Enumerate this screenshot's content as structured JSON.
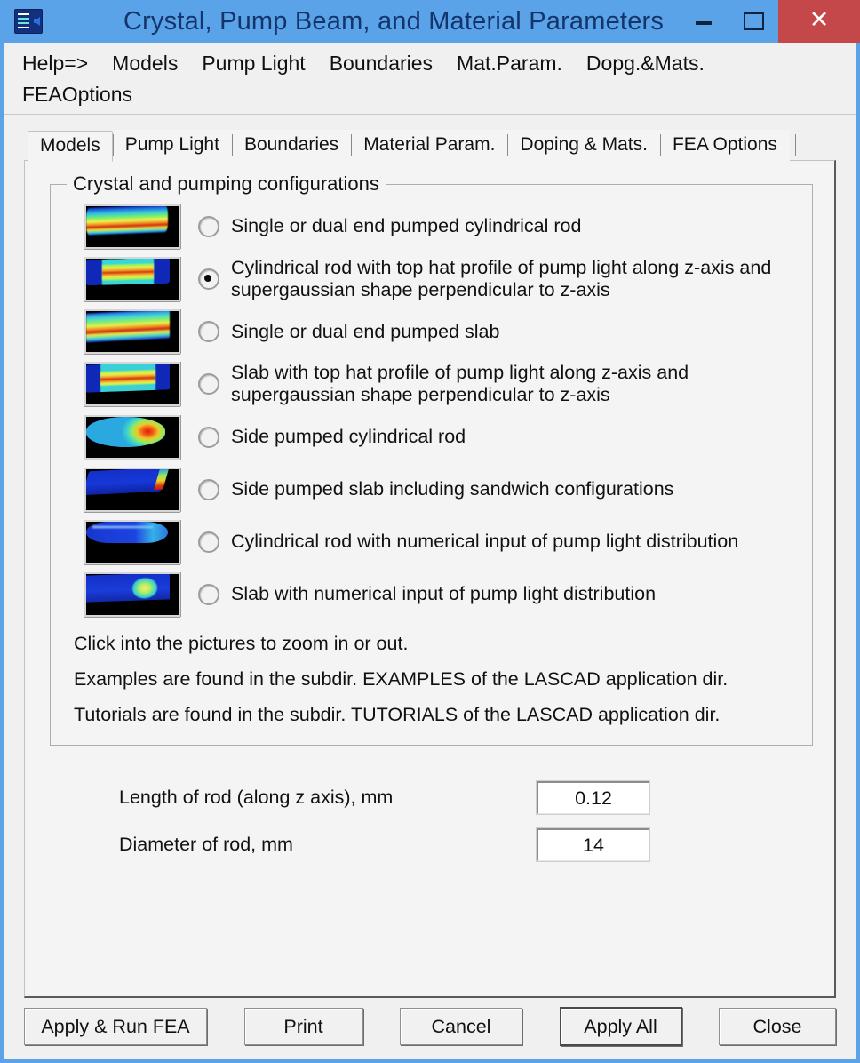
{
  "window": {
    "title": "Crystal, Pump Beam, and Material Parameters",
    "icon": "app-window-icon",
    "minimize_label": "–",
    "maximize_label": "□",
    "close_label": "✕",
    "titlebar_color": "#5BA3E8",
    "close_button_color": "#C4484A"
  },
  "menu": {
    "row1": [
      {
        "label": "Help=>"
      },
      {
        "label": "Models"
      },
      {
        "label": "Pump Light"
      },
      {
        "label": "Boundaries"
      },
      {
        "label": "Mat.Param."
      },
      {
        "label": "Dopg.&Mats."
      }
    ],
    "row2": [
      {
        "label": "FEAOptions"
      }
    ]
  },
  "tabs": [
    {
      "label": "Models",
      "active": true
    },
    {
      "label": "Pump Light",
      "active": false
    },
    {
      "label": "Boundaries",
      "active": false
    },
    {
      "label": "Material Param.",
      "active": false
    },
    {
      "label": "Doping & Mats.",
      "active": false
    },
    {
      "label": "FEA Options",
      "active": false
    }
  ],
  "group": {
    "legend": "Crystal and pumping configurations",
    "options": [
      {
        "label": "Single or dual end pumped cylindrical rod",
        "selected": false,
        "thumb": "end-pumped-rod-thumbnail"
      },
      {
        "label": "Cylindrical rod with top hat profile of pump light along z-axis and supergaussian shape perpendicular to z-axis",
        "selected": true,
        "thumb": "tophat-rod-thumbnail"
      },
      {
        "label": "Single or dual end pumped slab",
        "selected": false,
        "thumb": "end-pumped-slab-thumbnail"
      },
      {
        "label": "Slab with top hat profile of pump light along z-axis and supergaussian shape perpendicular to z-axis",
        "selected": false,
        "thumb": "tophat-slab-thumbnail"
      },
      {
        "label": "Side pumped cylindrical rod",
        "selected": false,
        "thumb": "side-pumped-rod-thumbnail"
      },
      {
        "label": "Side pumped slab including sandwich configurations",
        "selected": false,
        "thumb": "side-pumped-slab-thumbnail"
      },
      {
        "label": "Cylindrical rod with numerical input of pump light distribution",
        "selected": false,
        "thumb": "numerical-rod-thumbnail"
      },
      {
        "label": "Slab with numerical input of pump light distribution",
        "selected": false,
        "thumb": "numerical-slab-thumbnail"
      }
    ],
    "help": [
      "Click into the pictures to zoom in or out.",
      "Examples are found in the subdir. EXAMPLES of the LASCAD application dir.",
      "Tutorials are found in the subdir. TUTORIALS of the LASCAD application dir."
    ]
  },
  "params": [
    {
      "label": "Length of rod (along z axis), mm",
      "value": "0.12"
    },
    {
      "label": "Diameter of rod, mm",
      "value": "14"
    }
  ],
  "buttons": [
    {
      "label": "Apply  &  Run FEA",
      "default": false
    },
    {
      "label": "Print",
      "default": false
    },
    {
      "label": "Cancel",
      "default": false
    },
    {
      "label": "Apply All",
      "default": true
    },
    {
      "label": "Close",
      "default": false
    }
  ]
}
